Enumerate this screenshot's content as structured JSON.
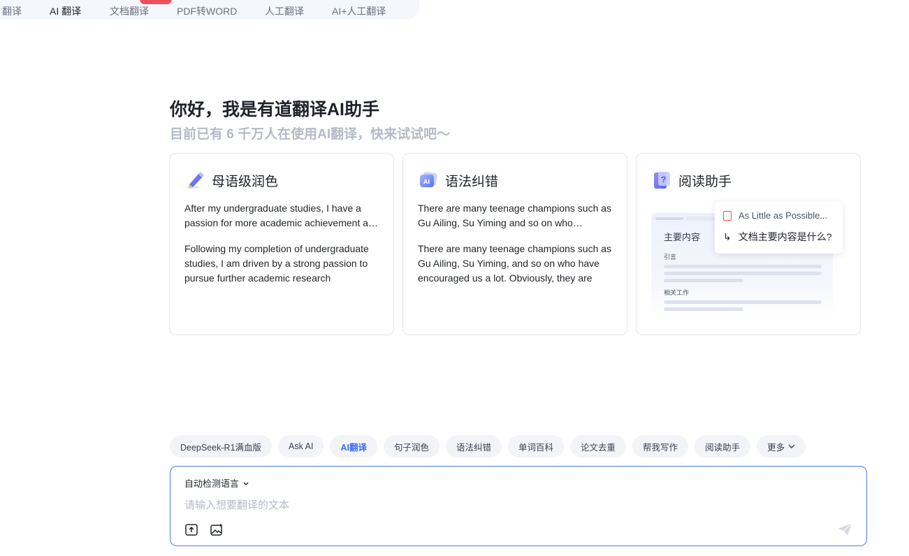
{
  "nav": {
    "tabs": [
      {
        "label": "翻译"
      },
      {
        "label": "AI 翻译"
      },
      {
        "label": "文档翻译"
      },
      {
        "label": "PDF转WORD"
      },
      {
        "label": "人工翻译"
      },
      {
        "label": "AI+人工翻译"
      }
    ],
    "active_index": 1
  },
  "hero": {
    "title": "你好，我是有道翻译AI助手",
    "subtitle": "目前已有 6 千万人在使用AI翻译，快来试试吧～"
  },
  "cards": [
    {
      "title": "母语级润色",
      "icon": "pen-icon",
      "before": "After my undergraduate studies, I have a passion for more academic achievement and research",
      "after": "Following my completion of undergraduate studies, I am driven by a strong passion to pursue further academic research"
    },
    {
      "title": "语法纠错",
      "icon": "ai-icon",
      "before": "There are many teenage champions such as Gu Ailing, Su Yiming and so on who encourage us",
      "after": "There are many teenage champions such as Gu Ailing, Su Yiming, and so on who have encouraged us a lot. Obviously, they are"
    },
    {
      "title": "阅读助手",
      "icon": "book-icon",
      "preview": {
        "doc_heading": "主要内容",
        "section1": "引言",
        "section2": "相关工作",
        "popup_file": "As Little as Possible...",
        "popup_question": "文档主要内容是什么?"
      }
    }
  ],
  "chips": [
    {
      "label": "DeepSeek-R1满血版"
    },
    {
      "label": "Ask AI"
    },
    {
      "label": "AI翻译",
      "active": true
    },
    {
      "label": "句子润色"
    },
    {
      "label": "语法纠错"
    },
    {
      "label": "单词百科"
    },
    {
      "label": "论文去重"
    },
    {
      "label": "帮我写作"
    },
    {
      "label": "阅读助手"
    },
    {
      "label": "更多"
    }
  ],
  "input": {
    "language": "自动检测语言",
    "placeholder": "请输入想要翻译的文本",
    "value": ""
  },
  "colors": {
    "accent": "#3b6cf6",
    "border_active": "#4f7be8",
    "badge": "#f0505a",
    "subtitle": "#b5bac4"
  }
}
